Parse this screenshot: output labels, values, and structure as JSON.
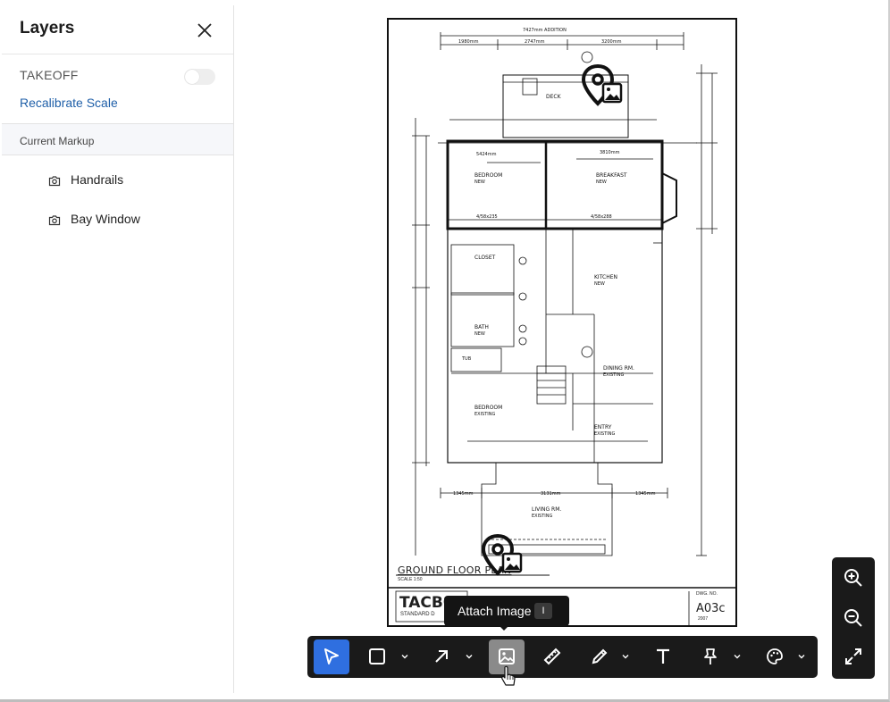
{
  "sidebar": {
    "title": "Layers",
    "takeoff_label": "TAKEOFF",
    "recalibrate_label": "Recalibrate Scale",
    "section_label": "Current Markup",
    "items": [
      {
        "label": "Handrails",
        "icon": "camera-icon"
      },
      {
        "label": "Bay Window",
        "icon": "camera-icon"
      }
    ]
  },
  "drawing": {
    "plan_title": "GROUND FLOOR PLAN",
    "plan_scale": "SCALE 1:50",
    "title_block_logo": "TACBO",
    "title_block_sub": "STANDARD D",
    "dwg_no_label": "DWG. NO.",
    "dwg_no": "A03c",
    "year": "2007",
    "rooms": {
      "deck": "DECK",
      "bedroom_new": "BEDROOM",
      "breakfast": "BREAKFAST",
      "closet": "CLOSET",
      "kitchen": "KITCHEN",
      "bath": "BATH",
      "dining": "DINING RM.",
      "bedroom_existing": "BEDROOM",
      "entry": "ENTRY",
      "living": "LIVING RM.",
      "tub": "TUB",
      "new": "NEW",
      "existing": "EXISTING"
    },
    "dims": {
      "top": "7427mm ADDITION",
      "d1": "1980mm",
      "d2": "2747mm",
      "d3": "3200mm",
      "d4": "5424mm",
      "d5": "3810mm",
      "d6": "1345mm",
      "d7": "3131mm",
      "d8": "1345mm",
      "d9": "4/58x235",
      "d10": "4/58x288"
    }
  },
  "tooltip": {
    "label": "Attach Image",
    "shortcut": "I"
  },
  "toolbar": {
    "tools": [
      {
        "name": "select-tool",
        "icon": "cursor-icon"
      },
      {
        "name": "rectangle-tool",
        "icon": "square-icon"
      },
      {
        "name": "arrow-tool",
        "icon": "arrow-icon"
      },
      {
        "name": "attach-image-tool",
        "icon": "image-icon"
      },
      {
        "name": "measure-tool",
        "icon": "ruler-icon"
      },
      {
        "name": "pencil-tool",
        "icon": "pencil-icon"
      },
      {
        "name": "text-tool",
        "icon": "text-icon"
      },
      {
        "name": "pin-tool",
        "icon": "pin-icon"
      },
      {
        "name": "color-tool",
        "icon": "palette-icon"
      }
    ],
    "active_color": "#2f6fe0"
  },
  "zoom": {
    "in": "zoom-in-icon",
    "out": "zoom-out-icon",
    "fit": "expand-icon"
  }
}
